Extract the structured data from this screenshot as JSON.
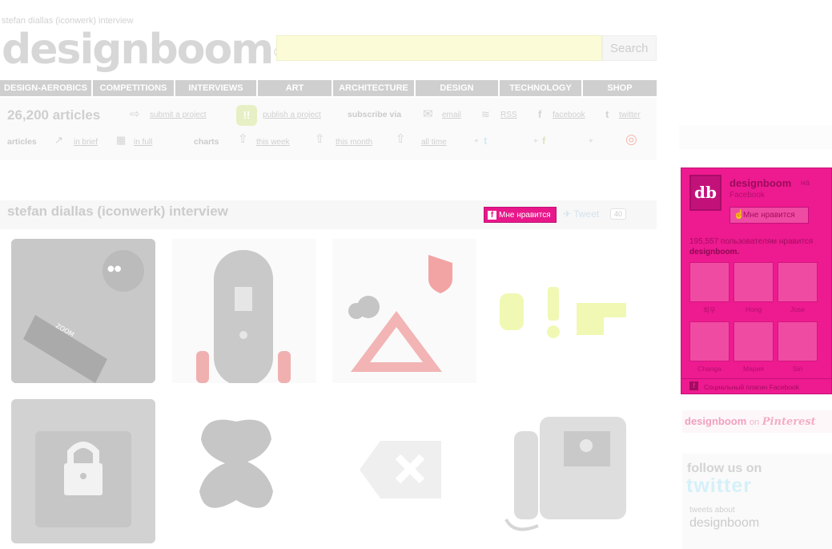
{
  "header": {
    "tagline": "stefan diallas (iconwerk) interview",
    "logo": "designboom",
    "logo_mark": "®",
    "search_placeholder": "",
    "search_button": "Search"
  },
  "nav": {
    "items": [
      "DESIGN-AEROBICS",
      "COMPETITIONS",
      "INTERVIEWS",
      "ART",
      "ARCHITECTURE",
      "DESIGN",
      "TECHNOLOGY",
      "SHOP"
    ]
  },
  "stats": {
    "count": "26,200 articles",
    "submit": "submit a project",
    "publish": "publish a project",
    "subscribe_label": "subscribe via",
    "email": "email",
    "rss": "RSS",
    "facebook": "facebook",
    "twitter": "twitter",
    "articles_label": "articles",
    "in_brief": "in brief",
    "in_full": "in full",
    "charts_label": "charts",
    "this_week": "this week",
    "this_month": "this month",
    "all_time": "all time",
    "plus": "+"
  },
  "article": {
    "title": "stefan diallas (iconwerk) interview",
    "like_label": "Мне нравится",
    "tweet_label": "Tweet",
    "tweet_count": "40"
  },
  "fb_widget": {
    "page_name": "designboom",
    "na": "на",
    "sub": "Facebook",
    "like_label": "Мне нравится",
    "count_line": "195,557 пользователям нравится",
    "count_name": "designboom.",
    "faces": [
      "최우",
      "Hong",
      "Jose",
      "Changa",
      "Мария",
      "Siri"
    ],
    "footer": "Социальный плагин Facebook"
  },
  "pinterest": {
    "brand": "designboom",
    "on": "on",
    "service": "Pinterest"
  },
  "twitter_box": {
    "follow": "follow us on",
    "service": "twitter",
    "about": "tweets about",
    "handle": "designboom"
  },
  "colors": {
    "accent": "#ee1a90",
    "nav_bg": "#cfcfcf",
    "search_bg": "#fbfbd8"
  }
}
